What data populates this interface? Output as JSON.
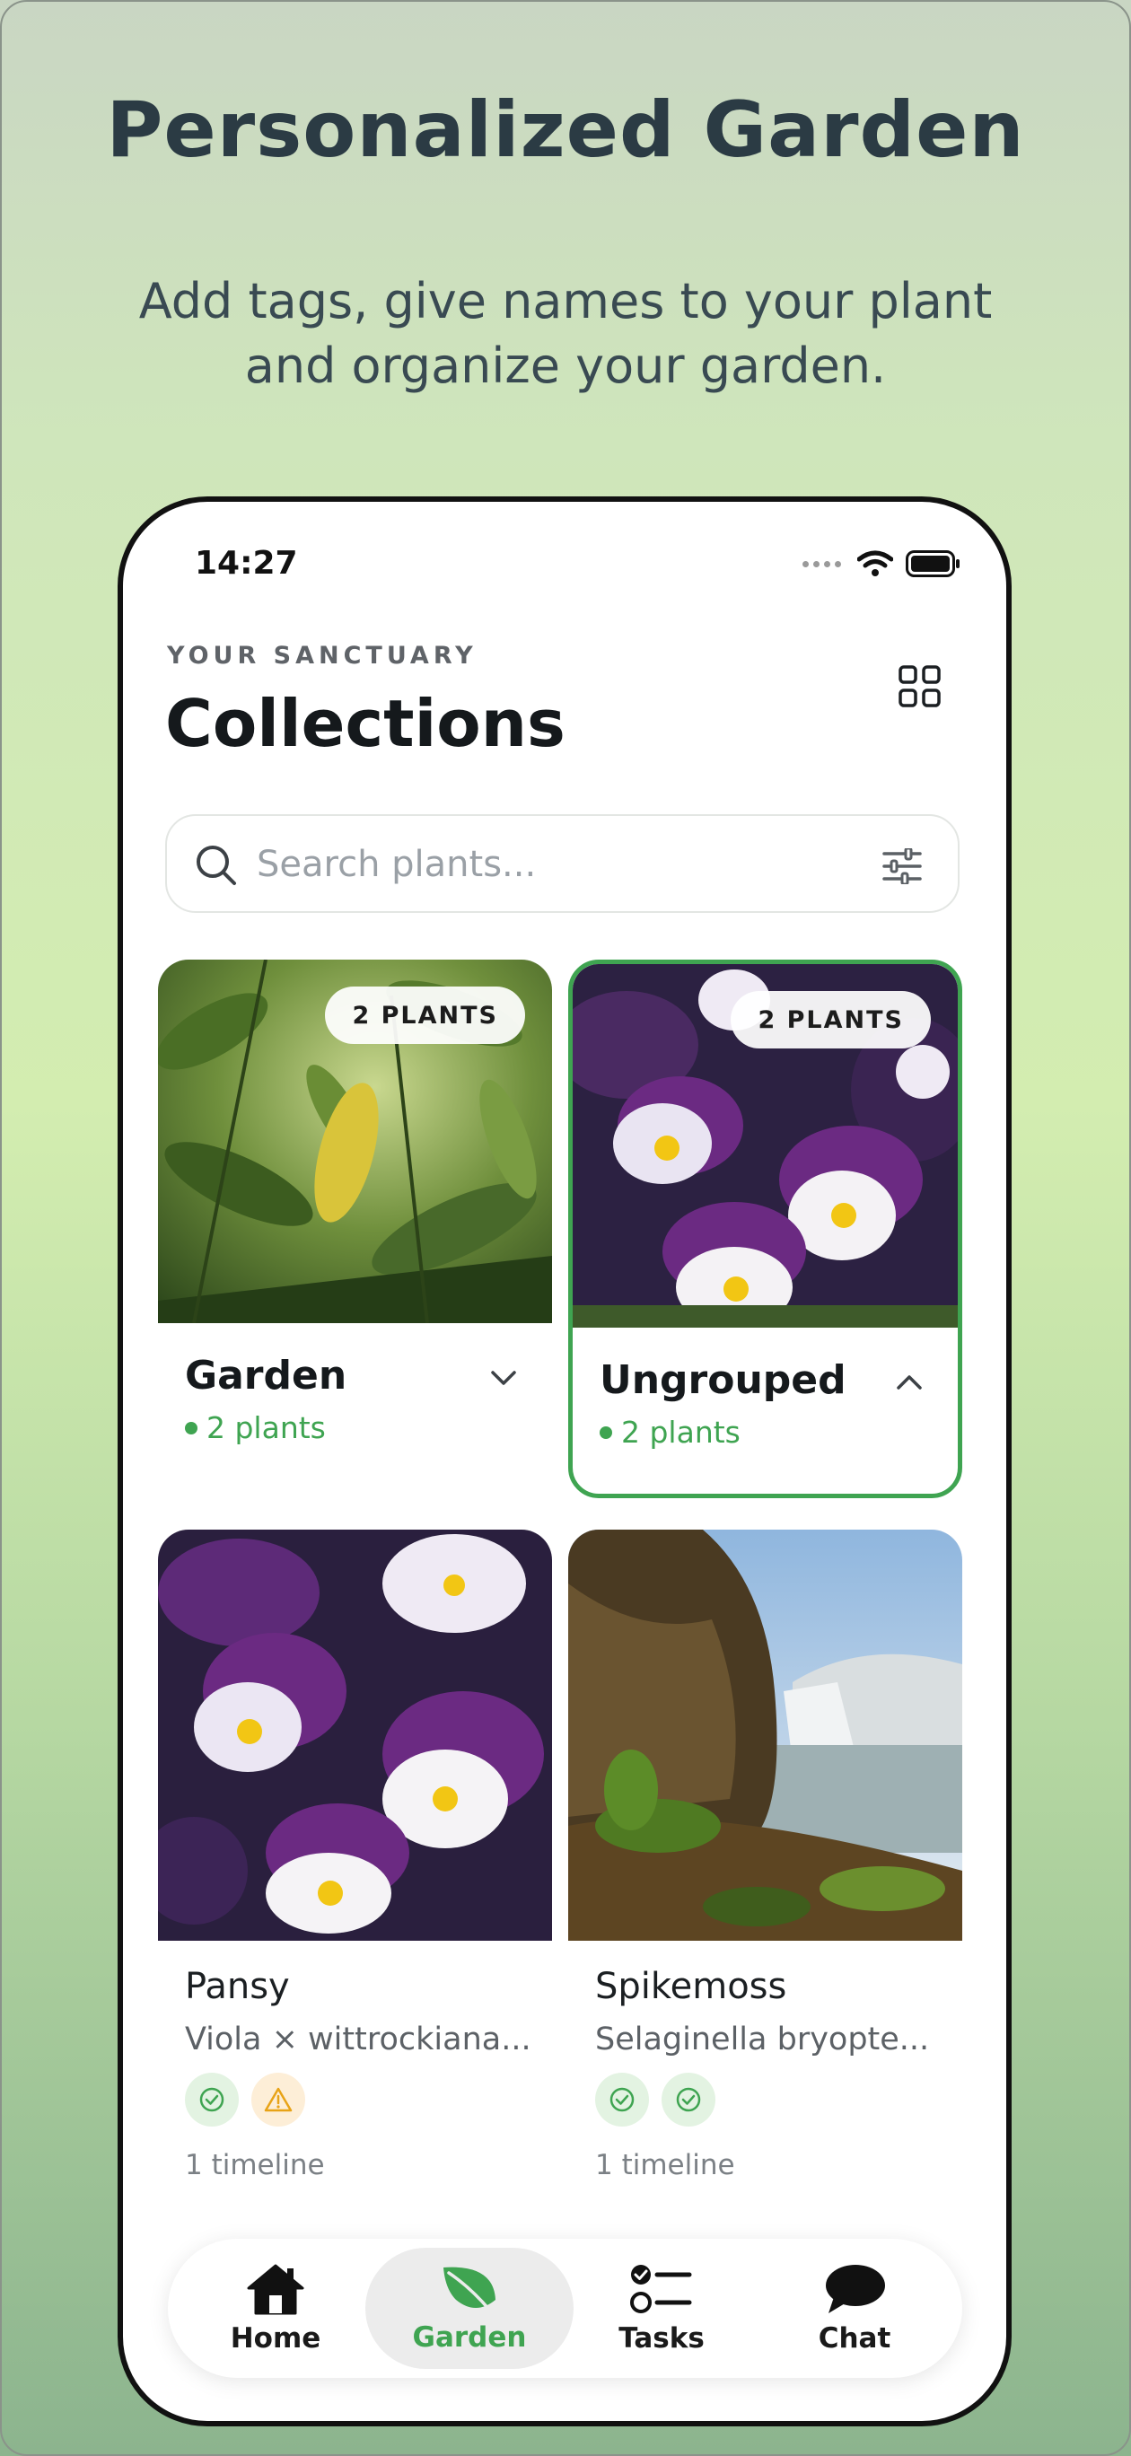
{
  "promo": {
    "headline": "Personalized Garden",
    "subline": "Add tags, give names to your plant and organize your garden."
  },
  "status_bar": {
    "time": "14:27",
    "icons": [
      "cellular-dots-icon",
      "wifi-icon",
      "battery-icon"
    ]
  },
  "header": {
    "eyebrow": "YOUR SANCTUARY",
    "title": "Collections",
    "grid_icon": "grid-view-icon"
  },
  "search": {
    "placeholder": "Search plants...",
    "value": ""
  },
  "collections": [
    {
      "name": "Garden",
      "pill": "2 PLANTS",
      "count": "2 plants",
      "expanded": false,
      "selected": false
    },
    {
      "name": "Ungrouped",
      "pill": "2 PLANTS",
      "count": "2 plants",
      "expanded": true,
      "selected": true
    }
  ],
  "plants": [
    {
      "name": "Pansy",
      "scientific": "Viola × wittrockiana...",
      "statuses": [
        "check-icon",
        "warning-icon"
      ],
      "timeline": "1 timeline"
    },
    {
      "name": "Spikemoss",
      "scientific": "Selaginella bryopte...",
      "statuses": [
        "check-icon",
        "check-icon"
      ],
      "timeline": "1 timeline"
    }
  ],
  "tabs": [
    {
      "label": "Home",
      "icon": "home-icon",
      "active": false
    },
    {
      "label": "Garden",
      "icon": "leaf-icon",
      "active": true
    },
    {
      "label": "Tasks",
      "icon": "tasks-icon",
      "active": false
    },
    {
      "label": "Chat",
      "icon": "chat-icon",
      "active": false
    }
  ],
  "colors": {
    "accent": "#3fa451",
    "text": "#15191c",
    "warning": "#e8a317"
  }
}
